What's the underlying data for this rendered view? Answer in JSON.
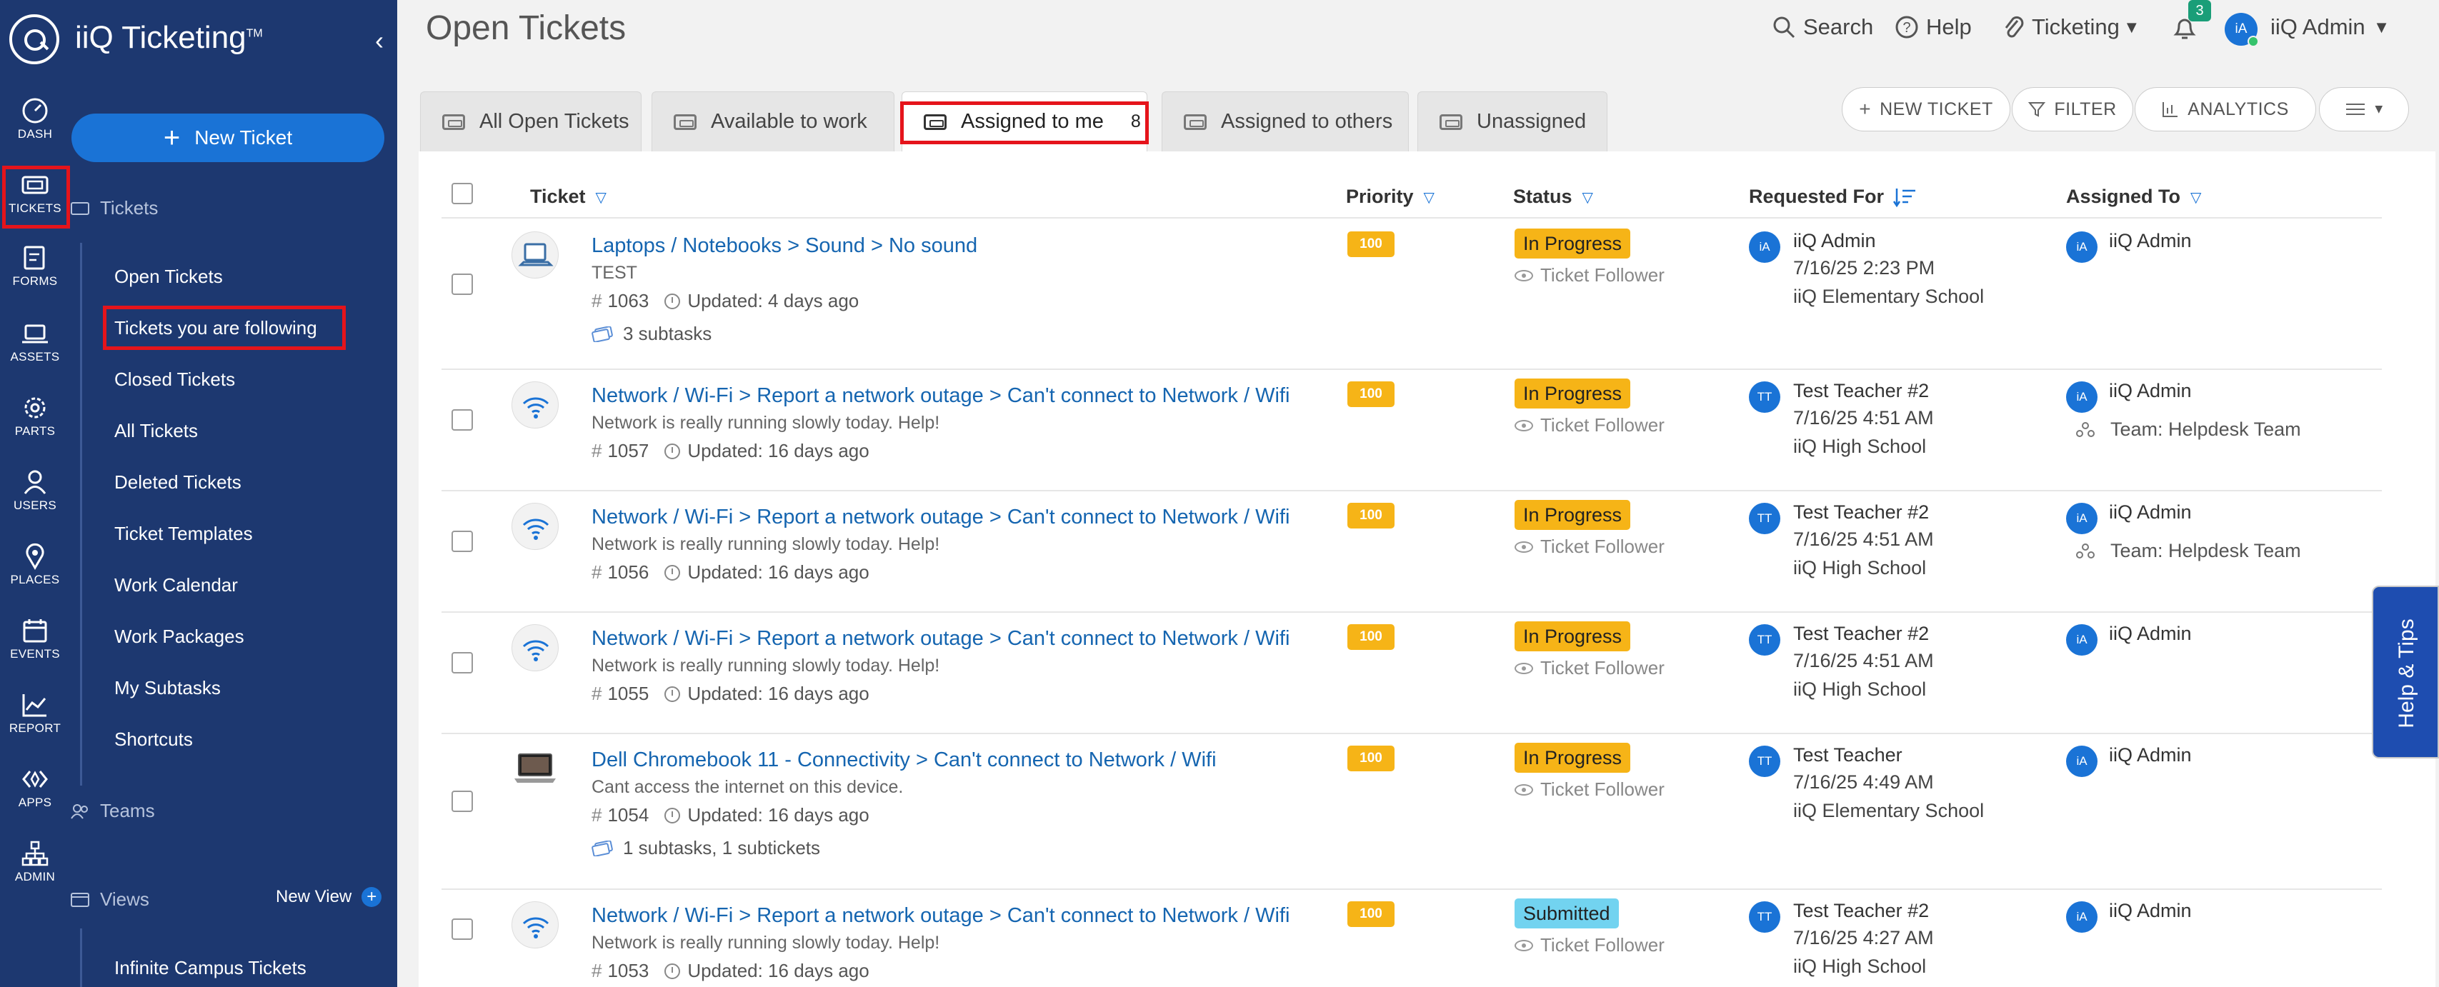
{
  "app": {
    "title": "iiQ Ticketing",
    "trademark": "TM",
    "new_ticket_label": "New Ticket"
  },
  "rail": [
    {
      "label": "DASH",
      "icon": "dashboard-icon"
    },
    {
      "label": "TICKETS",
      "icon": "ticket-icon"
    },
    {
      "label": "FORMS",
      "icon": "forms-icon"
    },
    {
      "label": "ASSETS",
      "icon": "laptop-icon"
    },
    {
      "label": "PARTS",
      "icon": "gear-icon"
    },
    {
      "label": "USERS",
      "icon": "user-icon"
    },
    {
      "label": "PLACES",
      "icon": "map-pin-icon"
    },
    {
      "label": "EVENTS",
      "icon": "calendar-icon"
    },
    {
      "label": "REPORT",
      "icon": "chart-icon"
    },
    {
      "label": "APPS",
      "icon": "apps-icon"
    },
    {
      "label": "ADMIN",
      "icon": "hierarchy-icon"
    }
  ],
  "sidebar": {
    "tickets_section": "Tickets",
    "items": [
      {
        "label": "Open Tickets"
      },
      {
        "label": "Tickets you are following"
      },
      {
        "label": "Closed Tickets"
      },
      {
        "label": "All Tickets"
      },
      {
        "label": "Deleted Tickets"
      },
      {
        "label": "Ticket Templates"
      },
      {
        "label": "Work Calendar"
      },
      {
        "label": "Work Packages"
      },
      {
        "label": "My Subtasks"
      },
      {
        "label": "Shortcuts"
      }
    ],
    "teams_section": "Teams",
    "views_section": "Views",
    "new_view_label": "New View",
    "views": [
      {
        "label": "Infinite Campus Tickets"
      }
    ]
  },
  "header": {
    "page_title": "Open Tickets",
    "search_label": "Search",
    "help_label": "Help",
    "module_label": "Ticketing",
    "notification_count": "3",
    "user_initials": "iA",
    "user_name": "iiQ Admin"
  },
  "tabs": [
    {
      "label": "All Open Tickets"
    },
    {
      "label": "Available to work"
    },
    {
      "label": "Assigned to me",
      "count": "8",
      "active": true
    },
    {
      "label": "Assigned to others"
    },
    {
      "label": "Unassigned"
    }
  ],
  "actions": {
    "new_ticket": "NEW TICKET",
    "filter": "FILTER",
    "analytics": "ANALYTICS"
  },
  "columns": {
    "ticket": "Ticket",
    "priority": "Priority",
    "status": "Status",
    "requested_for": "Requested For",
    "assigned_to": "Assigned To"
  },
  "tickets": [
    {
      "icon": "laptop-icon",
      "title": "Laptops / Notebooks > Sound > No sound",
      "desc": "TEST",
      "number": "1063",
      "updated": "Updated: 4 days ago",
      "subtasks": "3 subtasks",
      "priority": "100",
      "status": "In Progress",
      "follower": "Ticket Follower",
      "req_initials": "iA",
      "req_name": "iiQ Admin",
      "req_date": "7/16/25 2:23 PM",
      "req_school": "iiQ Elementary School",
      "assignee_initials": "iA",
      "assignee": "iiQ Admin",
      "team": ""
    },
    {
      "icon": "wifi-icon",
      "title": "Network / Wi-Fi > Report a network outage > Can't connect to Network / Wifi",
      "desc": "Network is really running slowly today. Help!",
      "number": "1057",
      "updated": "Updated: 16 days ago",
      "subtasks": "",
      "priority": "100",
      "status": "In Progress",
      "follower": "Ticket Follower",
      "req_initials": "TT",
      "req_name": "Test Teacher #2",
      "req_date": "7/16/25 4:51 AM",
      "req_school": "iiQ High School",
      "assignee_initials": "iA",
      "assignee": "iiQ Admin",
      "team": "Team: Helpdesk Team"
    },
    {
      "icon": "wifi-icon",
      "title": "Network / Wi-Fi > Report a network outage > Can't connect to Network / Wifi",
      "desc": "Network is really running slowly today. Help!",
      "number": "1056",
      "updated": "Updated: 16 days ago",
      "subtasks": "",
      "priority": "100",
      "status": "In Progress",
      "follower": "Ticket Follower",
      "req_initials": "TT",
      "req_name": "Test Teacher #2",
      "req_date": "7/16/25 4:51 AM",
      "req_school": "iiQ High School",
      "assignee_initials": "iA",
      "assignee": "iiQ Admin",
      "team": "Team: Helpdesk Team"
    },
    {
      "icon": "wifi-icon",
      "title": "Network / Wi-Fi > Report a network outage > Can't connect to Network / Wifi",
      "desc": "Network is really running slowly today. Help!",
      "number": "1055",
      "updated": "Updated: 16 days ago",
      "subtasks": "",
      "priority": "100",
      "status": "In Progress",
      "follower": "Ticket Follower",
      "req_initials": "TT",
      "req_name": "Test Teacher #2",
      "req_date": "7/16/25 4:51 AM",
      "req_school": "iiQ High School",
      "assignee_initials": "iA",
      "assignee": "iiQ Admin",
      "team": ""
    },
    {
      "icon": "chromebook-icon",
      "title": "Dell Chromebook 11 - Connectivity > Can't connect to Network / Wifi",
      "desc": "Cant access the internet on this device.",
      "number": "1054",
      "updated": "Updated: 16 days ago",
      "subtasks": "1 subtasks, 1 subtickets",
      "priority": "100",
      "status": "In Progress",
      "follower": "Ticket Follower",
      "req_initials": "TT",
      "req_name": "Test Teacher",
      "req_date": "7/16/25 4:49 AM",
      "req_school": "iiQ Elementary School",
      "assignee_initials": "iA",
      "assignee": "iiQ Admin",
      "team": ""
    },
    {
      "icon": "wifi-icon",
      "title": "Network / Wi-Fi > Report a network outage > Can't connect to Network / Wifi",
      "desc": "Network is really running slowly today. Help!",
      "number": "1053",
      "updated": "Updated: 16 days ago",
      "subtasks": "",
      "priority": "100",
      "status": "Submitted",
      "follower": "Ticket Follower",
      "req_initials": "TT",
      "req_name": "Test Teacher #2",
      "req_date": "7/16/25 4:27 AM",
      "req_school": "iiQ High School",
      "assignee_initials": "iA",
      "assignee": "iiQ Admin",
      "team": ""
    }
  ],
  "help_tips": "Help & Tips",
  "colors": {
    "sidebar_bg": "#1d3870",
    "accent": "#1a73d6",
    "priority_badge": "#f6b417",
    "status_in_progress": "#f6b417",
    "status_submitted": "#72d3f0",
    "highlight": "#e5141b"
  }
}
